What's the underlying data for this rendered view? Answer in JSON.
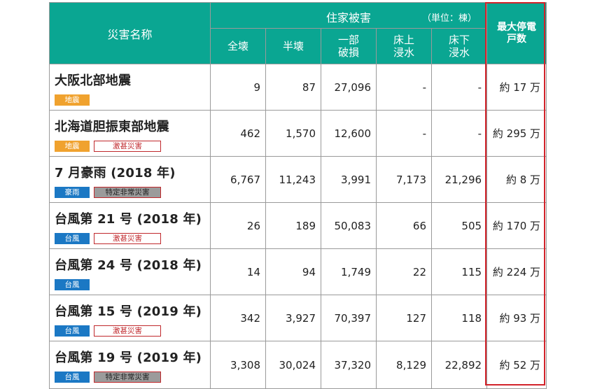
{
  "header": {
    "disaster_name": "災害名称",
    "housing_damage": "住家被害",
    "unit": "（単位：棟）",
    "cols": [
      "全壊",
      "半壊",
      "一部\n破損",
      "床上\n浸水",
      "床下\n浸水"
    ],
    "max_outage": "最大停電\n戸数"
  },
  "colors": {
    "header_bg": "#0aa692",
    "earthquake_tag": "#f0a22e",
    "rain_typhoon_tag": "#1b78c4",
    "highlight_border": "#d2232a"
  },
  "rows": [
    {
      "name": "大阪北部地震",
      "category": "地震",
      "designation": "",
      "values": [
        "9",
        "87",
        "27,096",
        "-",
        "-"
      ],
      "max_outage": "約 17 万"
    },
    {
      "name": "北海道胆振東部地震",
      "category": "地震",
      "designation": "激甚災害",
      "values": [
        "462",
        "1,570",
        "12,600",
        "-",
        "-"
      ],
      "max_outage": "約 295 万"
    },
    {
      "name": "7 月豪雨 (2018 年)",
      "category": "豪雨",
      "designation": "特定非常災害",
      "values": [
        "6,767",
        "11,243",
        "3,991",
        "7,173",
        "21,296"
      ],
      "max_outage": "約 8 万"
    },
    {
      "name": "台風第 21 号 (2018 年)",
      "category": "台風",
      "designation": "激甚災害",
      "values": [
        "26",
        "189",
        "50,083",
        "66",
        "505"
      ],
      "max_outage": "約 170 万"
    },
    {
      "name": "台風第 24 号 (2018 年)",
      "category": "台風",
      "designation": "",
      "values": [
        "14",
        "94",
        "1,749",
        "22",
        "115"
      ],
      "max_outage": "約 224 万"
    },
    {
      "name": "台風第 15 号 (2019 年)",
      "category": "台風",
      "designation": "激甚災害",
      "values": [
        "342",
        "3,927",
        "70,397",
        "127",
        "118"
      ],
      "max_outage": "約 93 万"
    },
    {
      "name": "台風第 19 号 (2019 年)",
      "category": "台風",
      "designation": "特定非常災害",
      "values": [
        "3,308",
        "30,024",
        "37,320",
        "8,129",
        "22,892"
      ],
      "max_outage": "約 52 万"
    }
  ]
}
